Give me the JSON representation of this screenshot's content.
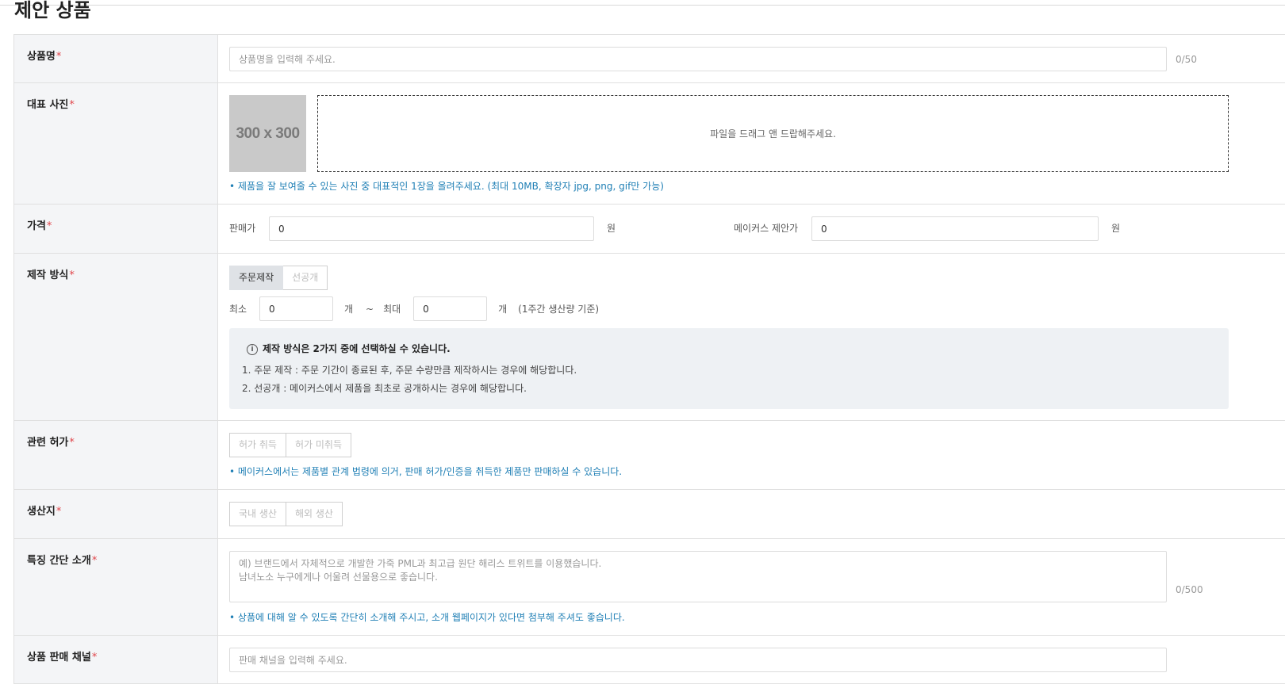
{
  "page_title": "제안 상품",
  "fields": {
    "product_name": {
      "label": "상품명",
      "required_mark": "*",
      "placeholder": "상품명을 입력해 주세요.",
      "counter": "0/50"
    },
    "main_photo": {
      "label": "대표 사진",
      "required_mark": "*",
      "thumb_text": "300 x 300",
      "dropzone_text": "파일을 드래그 앤 드랍해주세요.",
      "hint": "제품을 잘 보여줄 수 있는 사진 중 대표적인 1장을 올려주세요. (최대 10MB, 확장자 jpg, png, gif만 가능)"
    },
    "price": {
      "label": "가격",
      "required_mark": "*",
      "sale_label": "판매가",
      "sale_value": "0",
      "unit": "원",
      "proposal_label": "메이커스 제안가",
      "proposal_value": "0",
      "unit2": "원"
    },
    "production": {
      "label": "제작 방식",
      "required_mark": "*",
      "options": [
        "주문제작",
        "선공개"
      ],
      "min_label": "최소",
      "min_value": "0",
      "unit": "개",
      "tilde": "~",
      "max_label": "최대",
      "max_value": "0",
      "unit2": "개",
      "note": "(1주간 생산량 기준)",
      "info_icon": "info-icon",
      "info_title": "제작 방식은 2가지 중에 선택하실 수 있습니다.",
      "info_line1": "1. 주문 제작 : 주문 기간이 종료된 후, 주문 수량만큼 제작하시는 경우에 해당합니다.",
      "info_line2": "2. 선공개 : 메이커스에서 제품을 최초로 공개하시는 경우에 해당합니다."
    },
    "permit": {
      "label": "관련 허가",
      "required_mark": "*",
      "options": [
        "허가 취득",
        "허가 미취득"
      ],
      "hint": "메이커스에서는 제품별 관계 법령에 의거, 판매 허가/인증을 취득한 제품만 판매하실 수 있습니다."
    },
    "origin": {
      "label": "생산지",
      "required_mark": "*",
      "options": [
        "국내 생산",
        "해외 생산"
      ]
    },
    "features": {
      "label": "특징 간단 소개",
      "required_mark": "*",
      "placeholder": "예) 브랜드에서 자체적으로 개발한 가죽 PML과 최고급 원단 해리스 트위트를 이용했습니다.\n남녀노소 누구에게나 어울려 선물용으로 좋습니다.",
      "counter": "0/500",
      "hint": "상품에 대해 알 수 있도록 간단히 소개해 주시고, 소개 웹페이지가 있다면 첨부해 주셔도 좋습니다."
    },
    "channel": {
      "label": "상품 판매 채널",
      "required_mark": "*",
      "placeholder": "판매 채널을 입력해 주세요."
    }
  },
  "colors": {
    "label_bg": "#f4f5f7",
    "required": "#e0454a",
    "hint": "#1f7fb5",
    "active_segment": "#dfe2e6",
    "info_box": "#eef1f4"
  }
}
